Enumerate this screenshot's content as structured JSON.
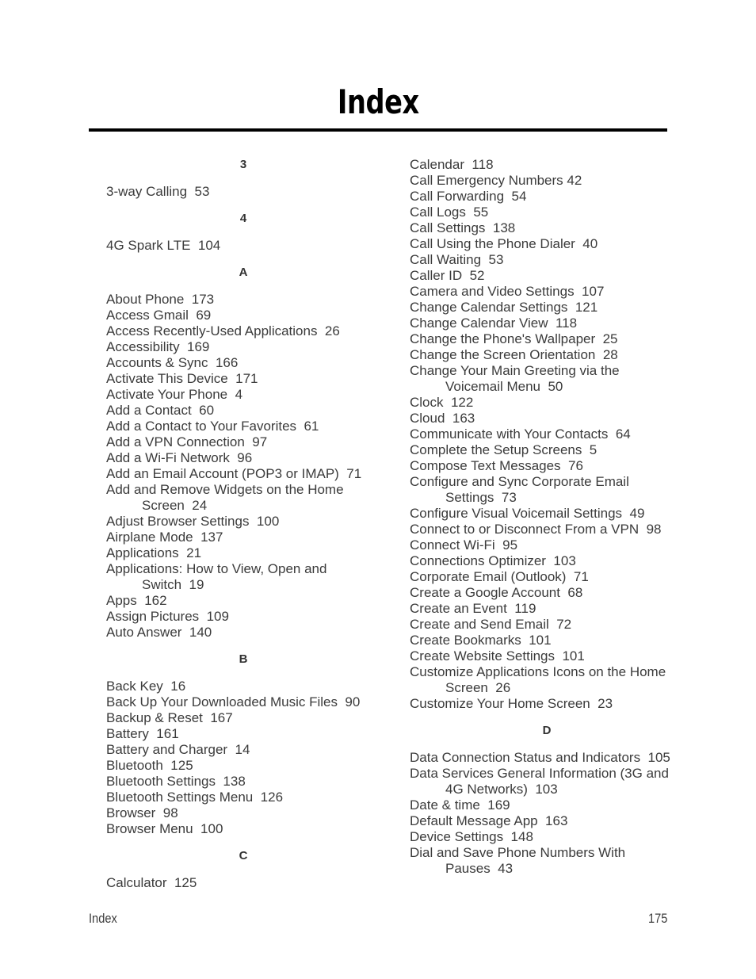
{
  "document": {
    "title": "Index",
    "footer_label": "Index",
    "page_number": "175",
    "text_color": "#3b3b3b",
    "rule_color": "#000000"
  },
  "columns": [
    {
      "id": "left",
      "sections": [
        {
          "letter": "3",
          "entries": [
            {
              "lines": [
                "3-way Calling  53"
              ]
            }
          ]
        },
        {
          "letter": "4",
          "entries": [
            {
              "lines": [
                "4G Spark LTE  104"
              ]
            }
          ]
        },
        {
          "letter": "A",
          "entries": [
            {
              "lines": [
                "About Phone  173"
              ]
            },
            {
              "lines": [
                "Access Gmail  69"
              ]
            },
            {
              "lines": [
                "Access Recently-Used Applications  26"
              ]
            },
            {
              "lines": [
                "Accessibility  169"
              ]
            },
            {
              "lines": [
                "Accounts & Sync  166"
              ]
            },
            {
              "lines": [
                "Activate This Device  171"
              ]
            },
            {
              "lines": [
                "Activate Your Phone  4"
              ]
            },
            {
              "lines": [
                "Add a Contact  60"
              ]
            },
            {
              "lines": [
                "Add a Contact to Your Favorites  61"
              ]
            },
            {
              "lines": [
                "Add a VPN Connection  97"
              ]
            },
            {
              "lines": [
                "Add a Wi-Fi Network  96"
              ]
            },
            {
              "lines": [
                "Add an Email Account (POP3 or IMAP)  71"
              ]
            },
            {
              "lines": [
                "Add and Remove Widgets on the Home",
                "Screen  24"
              ]
            },
            {
              "lines": [
                "Adjust Browser Settings  100"
              ]
            },
            {
              "lines": [
                "Airplane Mode  137"
              ]
            },
            {
              "lines": [
                "Applications  21"
              ]
            },
            {
              "lines": [
                "Applications: How to View, Open and",
                "Switch  19"
              ]
            },
            {
              "lines": [
                "Apps  162"
              ]
            },
            {
              "lines": [
                "Assign Pictures  109"
              ]
            },
            {
              "lines": [
                "Auto Answer  140"
              ]
            }
          ]
        },
        {
          "letter": "B",
          "entries": [
            {
              "lines": [
                "Back Key  16"
              ]
            },
            {
              "lines": [
                "Back Up Your Downloaded Music Files  90"
              ]
            },
            {
              "lines": [
                "Backup & Reset  167"
              ]
            },
            {
              "lines": [
                "Battery  161"
              ]
            },
            {
              "lines": [
                "Battery and Charger  14"
              ]
            },
            {
              "lines": [
                "Bluetooth  125"
              ]
            },
            {
              "lines": [
                "Bluetooth Settings  138"
              ]
            },
            {
              "lines": [
                "Bluetooth Settings Menu  126"
              ]
            },
            {
              "lines": [
                "Browser  98"
              ]
            },
            {
              "lines": [
                "Browser Menu  100"
              ]
            }
          ]
        },
        {
          "letter": "C",
          "entries": [
            {
              "lines": [
                "Calculator  125"
              ]
            }
          ]
        }
      ]
    },
    {
      "id": "right",
      "sections": [
        {
          "letter": "",
          "entries": [
            {
              "lines": [
                "Calendar  118"
              ]
            },
            {
              "lines": [
                "Call Emergency Numbers 42"
              ]
            },
            {
              "lines": [
                "Call Forwarding  54"
              ]
            },
            {
              "lines": [
                "Call Logs  55"
              ]
            },
            {
              "lines": [
                "Call Settings  138"
              ]
            },
            {
              "lines": [
                "Call Using the Phone Dialer  40"
              ]
            },
            {
              "lines": [
                "Call Waiting  53"
              ]
            },
            {
              "lines": [
                "Caller ID  52"
              ]
            },
            {
              "lines": [
                "Camera and Video Settings  107"
              ]
            },
            {
              "lines": [
                "Change Calendar Settings  121"
              ]
            },
            {
              "lines": [
                "Change Calendar View  118"
              ]
            },
            {
              "lines": [
                "Change the Phone's Wallpaper  25"
              ]
            },
            {
              "lines": [
                "Change the Screen Orientation  28"
              ]
            },
            {
              "lines": [
                "Change Your Main Greeting via the",
                "Voicemail Menu  50"
              ]
            },
            {
              "lines": [
                "Clock  122"
              ]
            },
            {
              "lines": [
                "Cloud  163"
              ]
            },
            {
              "lines": [
                "Communicate with Your Contacts  64"
              ]
            },
            {
              "lines": [
                "Complete the Setup Screens  5"
              ]
            },
            {
              "lines": [
                "Compose Text Messages  76"
              ]
            },
            {
              "lines": [
                "Configure and Sync Corporate Email",
                "Settings  73"
              ]
            },
            {
              "lines": [
                "Configure Visual Voicemail Settings  49"
              ]
            },
            {
              "lines": [
                "Connect to or Disconnect From a VPN  98"
              ]
            },
            {
              "lines": [
                "Connect Wi-Fi  95"
              ]
            },
            {
              "lines": [
                "Connections Optimizer  103"
              ]
            },
            {
              "lines": [
                "Corporate Email (Outlook)  71"
              ]
            },
            {
              "lines": [
                "Create a Google Account  68"
              ]
            },
            {
              "lines": [
                "Create an Event  119"
              ]
            },
            {
              "lines": [
                "Create and Send Email  72"
              ]
            },
            {
              "lines": [
                "Create Bookmarks  101"
              ]
            },
            {
              "lines": [
                "Create Website Settings  101"
              ]
            },
            {
              "lines": [
                "Customize Applications Icons on the Home",
                "Screen  26"
              ]
            },
            {
              "lines": [
                "Customize Your Home Screen  23"
              ]
            }
          ]
        },
        {
          "letter": "D",
          "entries": [
            {
              "lines": [
                "Data Connection Status and Indicators  105"
              ]
            },
            {
              "lines": [
                "Data Services General Information (3G and",
                "4G Networks)  103"
              ]
            },
            {
              "lines": [
                "Date & time  169"
              ]
            },
            {
              "lines": [
                "Default Message App  163"
              ]
            },
            {
              "lines": [
                "Device Settings  148"
              ]
            },
            {
              "lines": [
                "Dial and Save Phone Numbers With",
                "Pauses  43"
              ]
            }
          ]
        }
      ]
    }
  ]
}
